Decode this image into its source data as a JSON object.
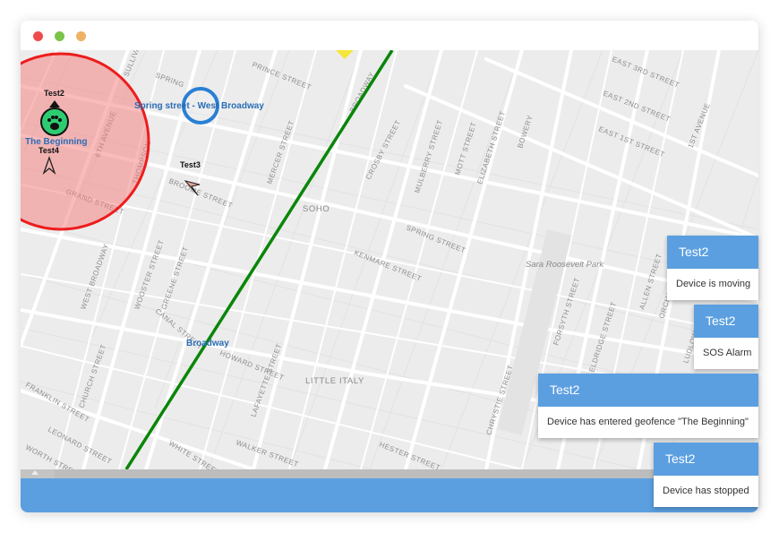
{
  "window": {
    "controls": [
      {
        "name": "close-control",
        "color": "#ef4b4b"
      },
      {
        "name": "minimize-control",
        "color": "#7cc34a"
      },
      {
        "name": "maximize-control",
        "color": "#f0b56a"
      }
    ]
  },
  "map": {
    "area_labels": [
      "SOHO",
      "LITTLE ITALY",
      "Sara Roosevelt Park"
    ],
    "street_labels": [
      "PRINCE STREET",
      "SPRING",
      "SULLIVAN",
      "6TH AVENUE",
      "THOMPSON",
      "GRAND STREET",
      "WEST BROADWAY",
      "WOOSTER STREET",
      "GREENE STREET",
      "MERCER STREET",
      "BROADWAY",
      "CROSBY STREET",
      "MULBERRY STREET",
      "MOTT STREET",
      "ELIZABETH STREET",
      "BOWERY",
      "EAST 3RD STREET",
      "EAST 2ND STREET",
      "EAST 1ST STREET",
      "1ST AVENUE",
      "KENMARE STREET",
      "SPRING STREET",
      "FORSYTH STREET",
      "ELDRIDGE STREET",
      "ALLEN STREET",
      "ORCHARD",
      "LUDLOW",
      "CANAL STREET",
      "HOWARD STREET",
      "LAFAYETTE STREET",
      "WALKER STREET",
      "WHITE STREET",
      "HESTER STREET",
      "CHRYSTIE STREET",
      "FRANKLIN STREET",
      "CHURCH STREET",
      "LEONARD STREET",
      "WORTH STREET",
      "BROOME STREET"
    ],
    "geofences": [
      {
        "name": "The Beginning",
        "color": "#ee1c1c"
      },
      {
        "name": "Spring street - West Broadway",
        "color": "#2a7fd4"
      },
      {
        "name": "Broadway",
        "color": "#008000"
      }
    ],
    "devices": [
      {
        "name": "Test2",
        "icon": "paw-icon",
        "color": "#2ecc71"
      },
      {
        "name": "Test4",
        "icon": "arrow-icon"
      },
      {
        "name": "Test3",
        "icon": "arrow-icon"
      }
    ]
  },
  "notifications": [
    {
      "title": "Test2",
      "message": "Device is moving"
    },
    {
      "title": "Test2",
      "message": "SOS Alarm"
    },
    {
      "title": "Test2",
      "message": "Device has entered geofence \"The Beginning\""
    },
    {
      "title": "Test2",
      "message": "Device has stopped"
    }
  ],
  "colors": {
    "accent": "#5b9fe0",
    "map_background": "#ececec",
    "geofence_fill": "#f59a9a"
  }
}
